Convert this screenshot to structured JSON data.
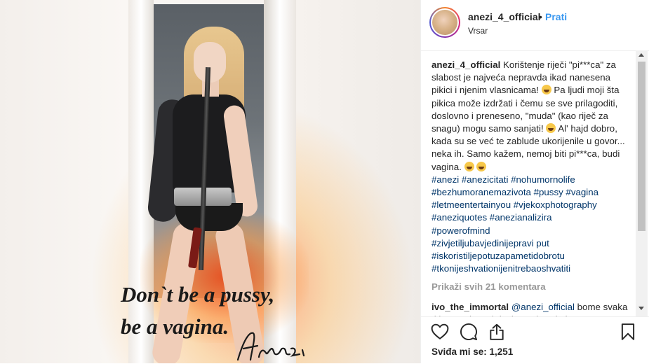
{
  "post": {
    "slogan_line1": "Don`t be a pussy,",
    "slogan_line2": "be a vagina.",
    "signature": "Anezi"
  },
  "header": {
    "username": "anezi_4_official",
    "separator": "•",
    "follow_label": "Prati",
    "location": "Vrsar"
  },
  "caption": {
    "username": "anezi_4_official",
    "text1": " Korištenje riječi \"pi***ca\" za slabost je najveća nepravda ikad nanesena pikici i njenim vlasnicama! ",
    "text2": " Pa ljudi moji šta pikica može izdržati i čemu se sve prilagoditi, doslovno i preneseno, \"muda\" (kao riječ za snagu) mogu samo sanjati! ",
    "text3": " Al' hajd dobro, kada su se već te zablude ukorijenile u govor... neka ih. Samo kažem, nemoj biti pi***ca, budi vagina. ",
    "hashtags": [
      "#anezi #anezicitati #nohumornolife",
      "#bezhumoranemazivota #pussy #vagina",
      "#letmeentertainyou #vjekoxphotography",
      "#aneziquotes #anezianalizira",
      "#powerofmind",
      "#zivjetiljubavjedinijepravi put",
      "#iskoristiljepotuzapametidobrotu",
      "#tkonijeshvationijenitrebaoshvatiti"
    ]
  },
  "view_all_comments": "Prikaži svih 21 komentara",
  "comment": {
    "username": "ivo_the_immortal",
    "mention": "@anezi_official",
    "text": " bome svaka ti je na mjestu i doslovno i svakako"
  },
  "likes_text": "Sviđa mi se: 1,251",
  "colors": {
    "link": "#3897f0",
    "hashtag": "#003569",
    "muted": "#999999"
  },
  "icons": [
    "heart-icon",
    "comment-icon",
    "share-icon",
    "bookmark-icon"
  ]
}
